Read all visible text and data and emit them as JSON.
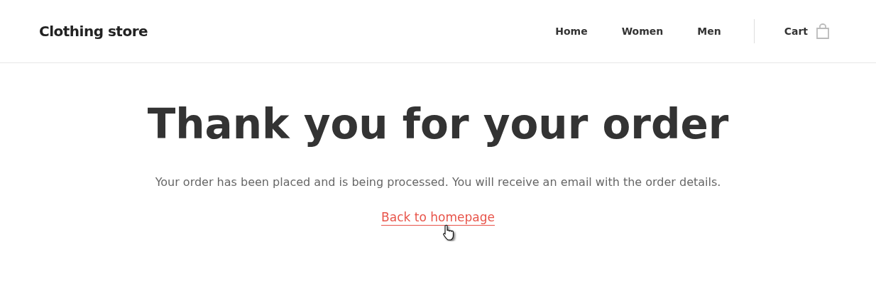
{
  "header": {
    "brand": "Clothing store",
    "nav": [
      {
        "label": "Home"
      },
      {
        "label": "Women"
      },
      {
        "label": "Men"
      }
    ],
    "cart": {
      "label": "Cart"
    }
  },
  "main": {
    "title": "Thank you for your order",
    "message": "Your order has been placed and is being processed. You will receive an email with the order details.",
    "link": "Back to homepage"
  }
}
